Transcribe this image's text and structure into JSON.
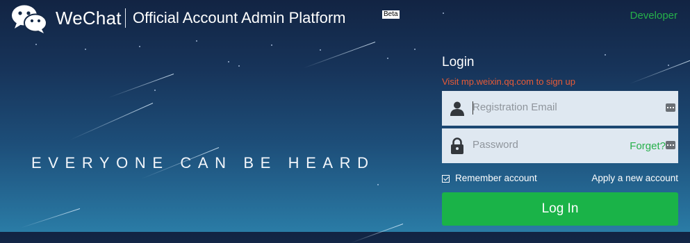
{
  "header": {
    "brand": "WeChat",
    "platform": "Official Account Admin Platform",
    "beta_badge": "Beta",
    "developer_link": "Developer"
  },
  "hero": {
    "slogan": "EVERYONE CAN BE HEARD"
  },
  "login": {
    "title": "Login",
    "signup_hint": "Visit mp.weixin.qq.com to sign up",
    "email_placeholder": "Registration Email",
    "password_placeholder": "Password",
    "forgot_link": "Forget?",
    "remember_label": "Remember account",
    "remember_checked": true,
    "apply_link": "Apply a new account",
    "submit_label": "Log In"
  },
  "icons": {
    "logo": "wechat-logo-icon",
    "user": "user-icon",
    "lock": "lock-icon",
    "autofill": "autofill-key-icon"
  },
  "colors": {
    "accent_green": "#1ab348",
    "link_green": "#26b04a",
    "hint_red": "#e85b37",
    "field_bg": "#dfe8f1"
  }
}
